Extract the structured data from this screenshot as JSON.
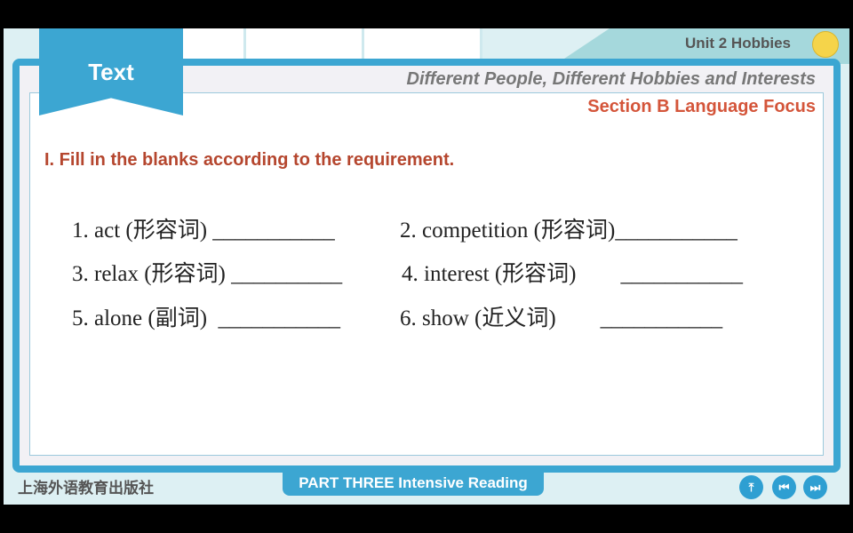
{
  "header": {
    "unit": "Unit 2 Hobbies",
    "tab": "Text",
    "subtitle": "Different People, Different Hobbies and Interests",
    "section": "Section B Language Focus"
  },
  "main": {
    "instruction": "I. Fill in the blanks according to the requirement.",
    "exercises": [
      {
        "text": "1. act (形容词) ___________"
      },
      {
        "text": "2. competition (形容词)___________"
      },
      {
        "text": "3. relax (形容词) __________"
      },
      {
        "text": "4. interest (形容词)        ___________"
      },
      {
        "text": "5. alone (副词)  ___________"
      },
      {
        "text": "6. show (近义词)        ___________"
      }
    ]
  },
  "footer": {
    "publisher": "上海外语教育出版社",
    "part": "PART THREE Intensive Reading",
    "nav": [
      {
        "icon": "home-up-icon",
        "glyph": "⤒"
      },
      {
        "icon": "previous-icon",
        "glyph": "⏮"
      },
      {
        "icon": "next-icon",
        "glyph": "⏭"
      }
    ]
  },
  "colors": {
    "accent": "#3ca6d2",
    "section": "#d4553a",
    "instruction": "#b5462e"
  }
}
